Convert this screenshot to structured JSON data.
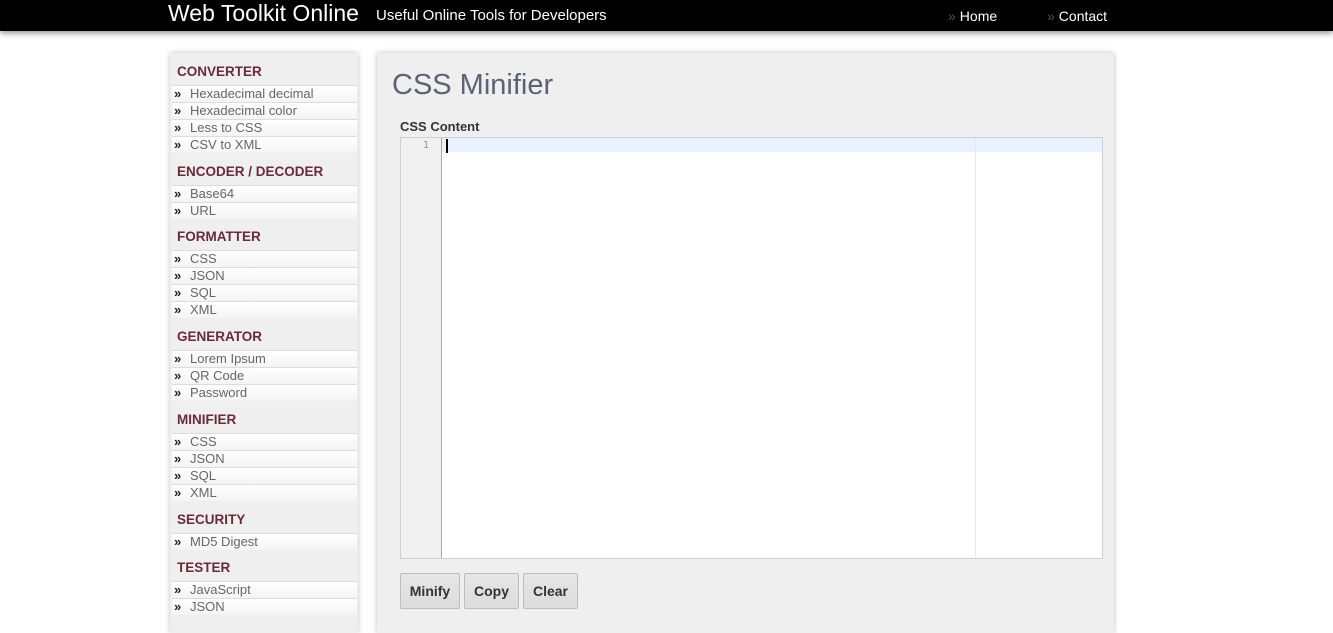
{
  "header": {
    "brand": "Web Toolkit Online",
    "tagline": "Useful Online Tools for Developers",
    "nav": [
      {
        "prefix": "»",
        "label": "Home"
      },
      {
        "prefix": "»",
        "label": "Contact"
      }
    ]
  },
  "sidebar": {
    "arrow": "»",
    "sections": [
      {
        "title": "CONVERTER",
        "items": [
          "Hexadecimal decimal",
          "Hexadecimal color",
          "Less to CSS",
          "CSV to XML"
        ]
      },
      {
        "title": "ENCODER / DECODER",
        "items": [
          "Base64",
          "URL"
        ]
      },
      {
        "title": "FORMATTER",
        "items": [
          "CSS",
          "JSON",
          "SQL",
          "XML"
        ]
      },
      {
        "title": "GENERATOR",
        "items": [
          "Lorem Ipsum",
          "QR Code",
          "Password"
        ]
      },
      {
        "title": "MINIFIER",
        "items": [
          "CSS",
          "JSON",
          "SQL",
          "XML"
        ]
      },
      {
        "title": "SECURITY",
        "items": [
          "MD5 Digest"
        ]
      },
      {
        "title": "TESTER",
        "items": [
          "JavaScript",
          "JSON"
        ]
      }
    ]
  },
  "main": {
    "title": "CSS Minifier",
    "field_label": "CSS Content",
    "editor": {
      "line_number": "1",
      "content": ""
    },
    "buttons": {
      "minify": "Minify",
      "copy": "Copy",
      "clear": "Clear"
    }
  }
}
